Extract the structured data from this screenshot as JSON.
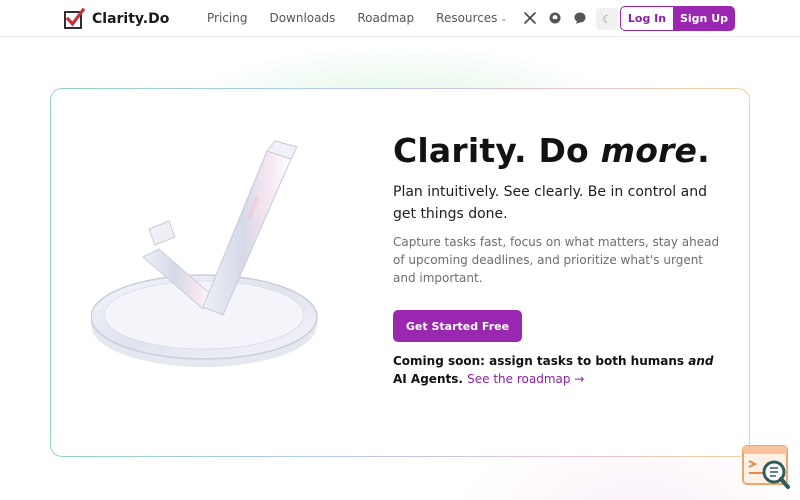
{
  "header": {
    "brand": "Clarity.Do",
    "nav": [
      "Pricing",
      "Downloads",
      "Roadmap",
      "Resources"
    ],
    "login_label": "Log In",
    "signup_label": "Sign Up",
    "theme_icon": "☾"
  },
  "hero": {
    "title_part1": "Clarity. Do ",
    "title_em": "more",
    "title_dot": ".",
    "subtitle": "Plan intuitively. See clearly. Be in control and get things done.",
    "description": "Capture tasks fast, focus on what matters, stay ahead of upcoming deadlines, and prioritize what's urgent and important.",
    "cta_label": "Get Started Free",
    "coming_soon_1": "Coming soon: assign tasks to both humans ",
    "coming_soon_em": "and",
    "coming_soon_2": " AI Agents.",
    "roadmap_link": "See the roadmap →"
  },
  "colors": {
    "accent": "#9a27b0",
    "brand_red": "#c8303a"
  },
  "icons": [
    "checkbox-logo-icon",
    "x-icon",
    "github-icon",
    "chat-icon",
    "moon-icon",
    "help-widget-icon"
  ]
}
